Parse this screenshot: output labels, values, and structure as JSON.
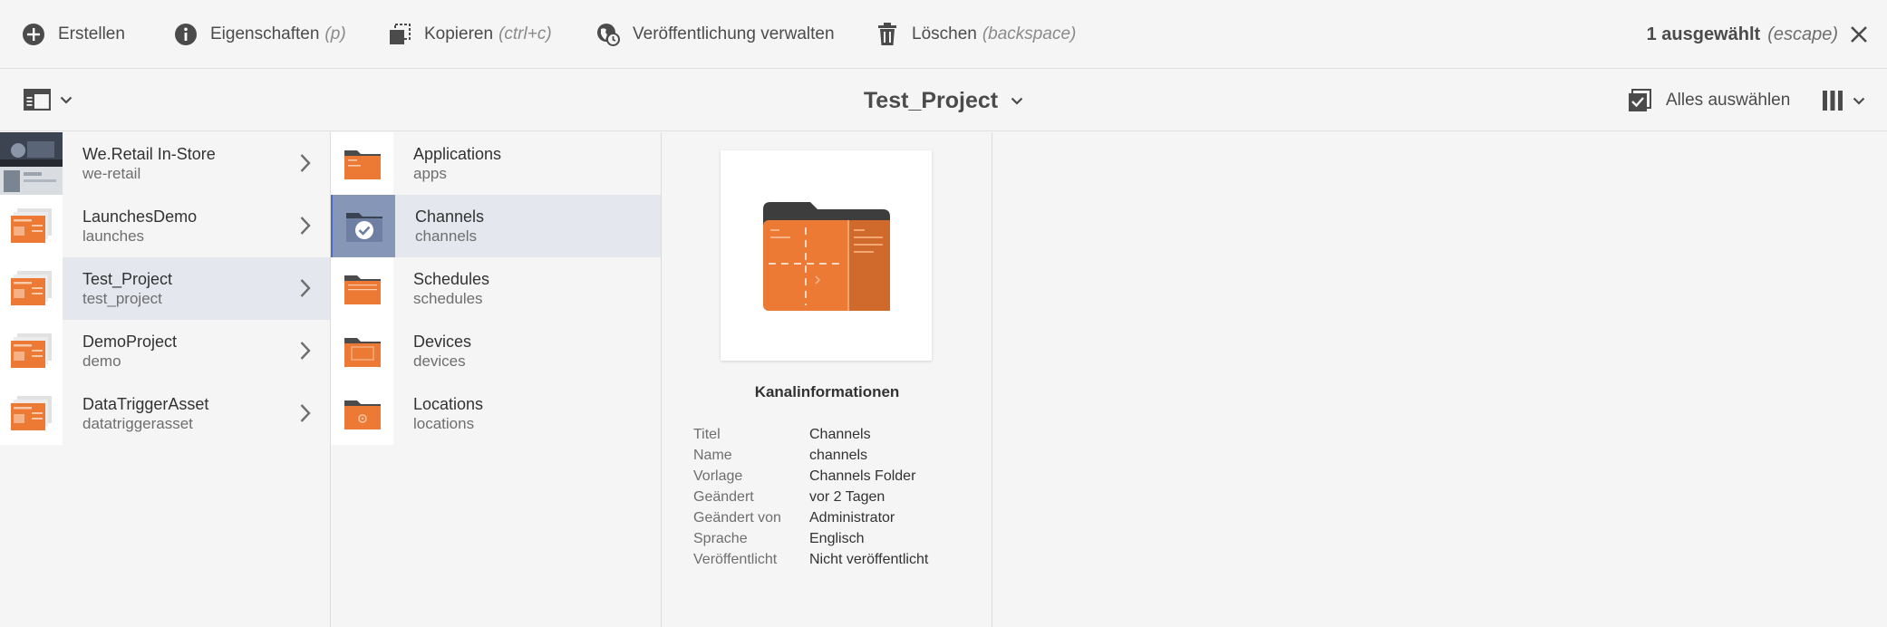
{
  "actionbar": {
    "create": "Erstellen",
    "properties": "Eigenschaften",
    "properties_hint": "(p)",
    "copy": "Kopieren",
    "copy_hint": "(ctrl+c)",
    "publish": "Veröffentlichung verwalten",
    "delete": "Löschen",
    "delete_hint": "(backspace)",
    "selection_count": "1 ausgewählt",
    "selection_hint": "(escape)"
  },
  "titlebar": {
    "title": "Test_Project",
    "select_all": "Alles auswählen"
  },
  "column1": [
    {
      "title": "We.Retail In-Store",
      "sub": "we-retail"
    },
    {
      "title": "LaunchesDemo",
      "sub": "launches"
    },
    {
      "title": "Test_Project",
      "sub": "test_project"
    },
    {
      "title": "DemoProject",
      "sub": "demo"
    },
    {
      "title": "DataTriggerAsset",
      "sub": "datatriggerasset"
    }
  ],
  "column2": [
    {
      "title": "Applications",
      "sub": "apps"
    },
    {
      "title": "Channels",
      "sub": "channels"
    },
    {
      "title": "Schedules",
      "sub": "schedules"
    },
    {
      "title": "Devices",
      "sub": "devices"
    },
    {
      "title": "Locations",
      "sub": "locations"
    }
  ],
  "preview": {
    "heading": "Kanalinformationen",
    "meta": [
      {
        "k": "Titel",
        "v": "Channels"
      },
      {
        "k": "Name",
        "v": "channels"
      },
      {
        "k": "Vorlage",
        "v": "Channels Folder"
      },
      {
        "k": "Geändert",
        "v": "vor 2 Tagen"
      },
      {
        "k": "Geändert von",
        "v": "Administrator"
      },
      {
        "k": "Sprache",
        "v": "Englisch"
      },
      {
        "k": "Veröffentlicht",
        "v": "Nicht veröffentlicht"
      }
    ]
  },
  "colors": {
    "accent_orange": "#ec7a35",
    "selection_bg": "#e4e8ee",
    "selected_thumb": "#8596b7"
  }
}
